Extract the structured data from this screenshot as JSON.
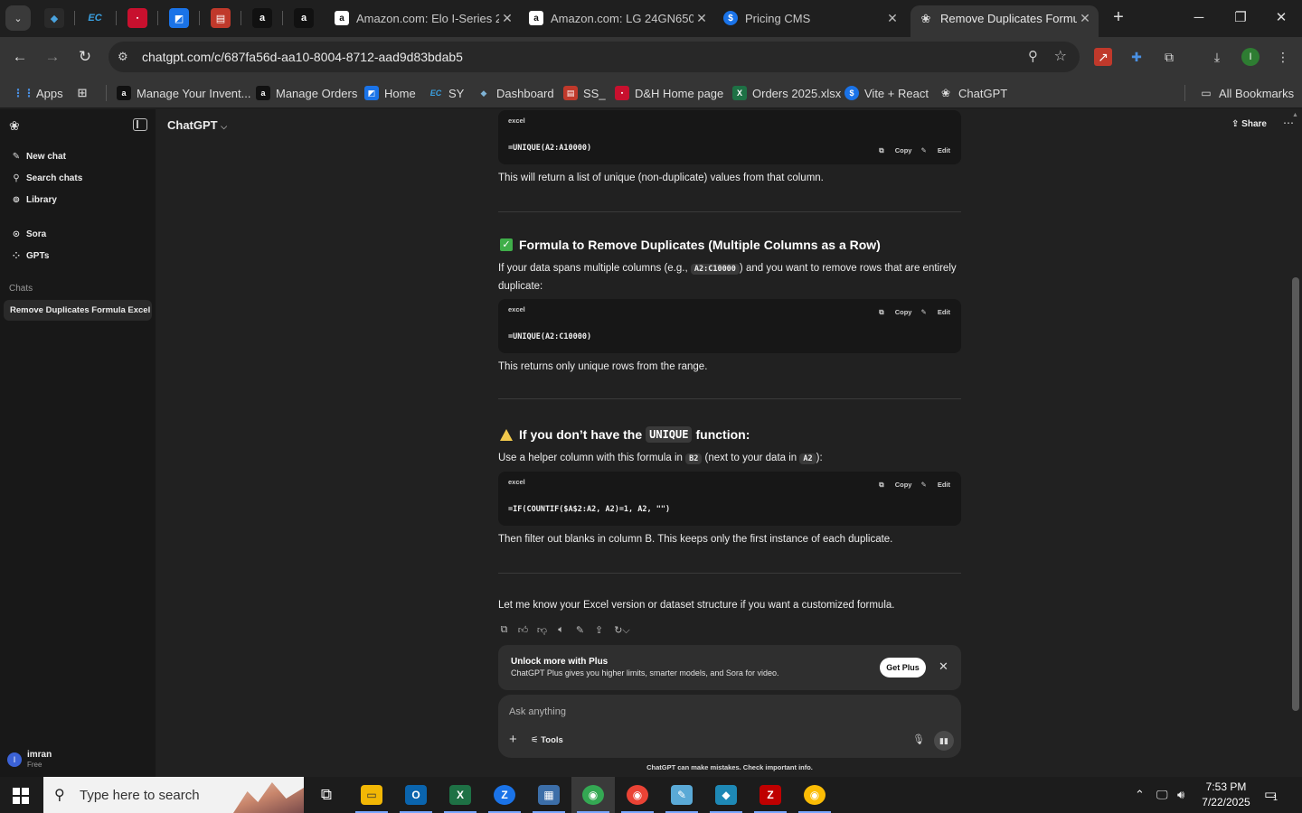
{
  "browser": {
    "pinned_tabs": [
      "EC"
    ],
    "tabs": [
      {
        "title": "Amazon.com: Elo I-Series 2"
      },
      {
        "title": "Amazon.com: LG 24GN650"
      },
      {
        "title": "Pricing CMS"
      },
      {
        "title": "Remove Duplicates Formul",
        "active": true
      }
    ],
    "url": "chatgpt.com/c/687fa56d-aa10-8004-8712-aad9d83bdab5",
    "bookmarks": [
      {
        "label": "Apps",
        "icon": "apps-grid-icon"
      },
      {
        "label": "Manage Your Invent...",
        "icon": "amazon-icon"
      },
      {
        "label": "Manage Orders",
        "icon": "amazon-icon"
      },
      {
        "label": "Home",
        "icon": "home-bookmark-icon"
      },
      {
        "label": "SY",
        "icon": "ec-icon"
      },
      {
        "label": "Dashboard",
        "icon": "dashboard-icon"
      },
      {
        "label": "SS_",
        "icon": "ss-icon"
      },
      {
        "label": "D&H Home page",
        "icon": "dh-icon"
      },
      {
        "label": "Orders 2025.xlsx",
        "icon": "excel-icon"
      },
      {
        "label": "Vite + React",
        "icon": "vite-icon"
      },
      {
        "label": "ChatGPT",
        "icon": "chatgpt-icon"
      }
    ],
    "all_bookmarks": "All Bookmarks",
    "profile_initial": "I"
  },
  "sidebar": {
    "items": [
      {
        "label": "New chat",
        "icon": "edit-icon"
      },
      {
        "label": "Search chats",
        "icon": "search-icon"
      },
      {
        "label": "Library",
        "icon": "library-icon"
      },
      {
        "label": "Sora",
        "icon": "sora-icon"
      },
      {
        "label": "GPTs",
        "icon": "gpts-icon"
      }
    ],
    "section_label": "Chats",
    "chats": [
      "Remove Duplicates Formula Excel"
    ],
    "user": {
      "initial": "I",
      "name": "imran",
      "plan": "Free"
    }
  },
  "header": {
    "model": "ChatGPT",
    "share_label": "Share"
  },
  "conversation": {
    "code_lang": "excel",
    "copy_label": "Copy",
    "edit_label": "Edit",
    "block1": {
      "code": "=UNIQUE(A2:A10000)",
      "after": "This will return a list of unique (non-duplicate) values from that column."
    },
    "section2": {
      "heading": "Formula to Remove Duplicates (Multiple Columns as a Row)",
      "intro_pre": "If your data spans multiple columns (e.g., ",
      "intro_code": "A2:C10000",
      "intro_post": ") and you want to remove rows that are entirely duplicate:",
      "code": "=UNIQUE(A2:C10000)",
      "after": "This returns only unique rows from the range."
    },
    "section3": {
      "heading_pre": "If you don’t have the",
      "heading_code": "UNIQUE",
      "heading_post": "function:",
      "intro_pre": "Use a helper column with this formula in ",
      "intro_code1": "B2",
      "intro_mid": " (next to your data in ",
      "intro_code2": "A2",
      "intro_post": "):",
      "code": "=IF(COUNTIF($A$2:A2, A2)=1, A2, \"\")",
      "after": "Then filter out blanks in column B. This keeps only the first instance of each duplicate."
    },
    "closing": "Let me know your Excel version or dataset structure if you want a customized formula."
  },
  "promo": {
    "title": "Unlock more with Plus",
    "desc": "ChatGPT Plus gives you higher limits, smarter models, and Sora for video.",
    "button": "Get Plus"
  },
  "composer": {
    "placeholder": "Ask anything",
    "tools_label": "Tools",
    "disclaimer": "ChatGPT can make mistakes. Check important info."
  },
  "taskbar": {
    "search_placeholder": "Type here to search",
    "time": "7:53 PM",
    "date": "7/22/2025",
    "notification_count": "1",
    "apps": [
      "file-explorer",
      "outlook",
      "excel",
      "zoho",
      "calculator",
      "chrome",
      "chrome-profile",
      "notepad",
      "app",
      "filezilla",
      "chrome-alt"
    ]
  }
}
